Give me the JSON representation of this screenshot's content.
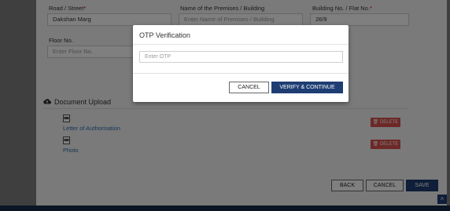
{
  "address": {
    "road_label": "Road / Street",
    "road_value": "Dakshan Marg",
    "premises_label": "Name of the Premises / Building",
    "premises_placeholder": "Enter Name of Premises / Building",
    "building_label": "Building No. / Flat No.",
    "building_value": "26/9",
    "floor_label": "Floor No.",
    "floor_placeholder": "Enter Floor No.",
    "required_mark": "*"
  },
  "documents": {
    "title": "Document Upload",
    "items": [
      {
        "label": "Letter of Authorisation",
        "delete_label": "DELETE"
      },
      {
        "label": "Photo",
        "delete_label": "DELETE"
      }
    ]
  },
  "actions": {
    "back": "BACK",
    "cancel": "CANCEL",
    "save": "SAVE"
  },
  "modal": {
    "title": "OTP Verification",
    "otp_placeholder": "Enter OTP",
    "cancel": "CANCEL",
    "verify": "VERIFY & CONTINUE"
  },
  "colors": {
    "primary": "#1e3d73",
    "danger": "#d9534f",
    "footer": "#122a48"
  }
}
